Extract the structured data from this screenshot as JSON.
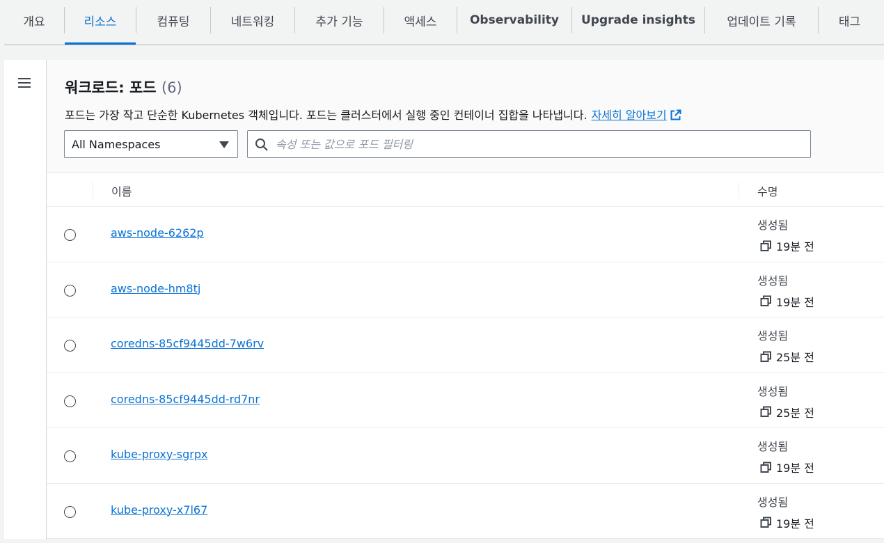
{
  "tabs": [
    {
      "label": "개요",
      "active": false,
      "bold": false
    },
    {
      "label": "리소스",
      "active": true,
      "bold": false
    },
    {
      "label": "컴퓨팅",
      "active": false,
      "bold": false
    },
    {
      "label": "네트워킹",
      "active": false,
      "bold": false
    },
    {
      "label": "추가 기능",
      "active": false,
      "bold": false
    },
    {
      "label": "액세스",
      "active": false,
      "bold": false
    },
    {
      "label": "Observability",
      "active": false,
      "bold": true
    },
    {
      "label": "Upgrade insights",
      "active": false,
      "bold": true
    },
    {
      "label": "업데이트 기록",
      "active": false,
      "bold": false
    },
    {
      "label": "태그",
      "active": false,
      "bold": false
    }
  ],
  "header": {
    "title": "워크로드: 포드",
    "count": "(6)",
    "description": "포드는 가장 작고 단순한 Kubernetes 객체입니다. 포드는 클러스터에서 실행 중인 컨테이너 집합을 나타냅니다.",
    "learn_more": "자세히 알아보기"
  },
  "filters": {
    "namespace_value": "All Namespaces",
    "search_placeholder": "속성 또는 값으로 포드 필터링"
  },
  "table": {
    "col_name": "이름",
    "col_lifecycle": "수명",
    "rows": [
      {
        "name": "aws-node-6262p",
        "status": "생성됨",
        "age": "19분 전"
      },
      {
        "name": "aws-node-hm8tj",
        "status": "생성됨",
        "age": "19분 전"
      },
      {
        "name": "coredns-85cf9445dd-7w6rv",
        "status": "생성됨",
        "age": "25분 전"
      },
      {
        "name": "coredns-85cf9445dd-rd7nr",
        "status": "생성됨",
        "age": "25분 전"
      },
      {
        "name": "kube-proxy-sgrpx",
        "status": "생성됨",
        "age": "19분 전"
      },
      {
        "name": "kube-proxy-x7l67",
        "status": "생성됨",
        "age": "19분 전"
      }
    ]
  },
  "colors": {
    "accent": "#0972d3",
    "text": "#16191f",
    "muted": "#414750"
  },
  "icons": {
    "menu": "hamburger-menu-icon",
    "external": "external-link-icon",
    "search": "search-icon",
    "caret": "caret-down-icon",
    "copy": "copy-icon"
  }
}
